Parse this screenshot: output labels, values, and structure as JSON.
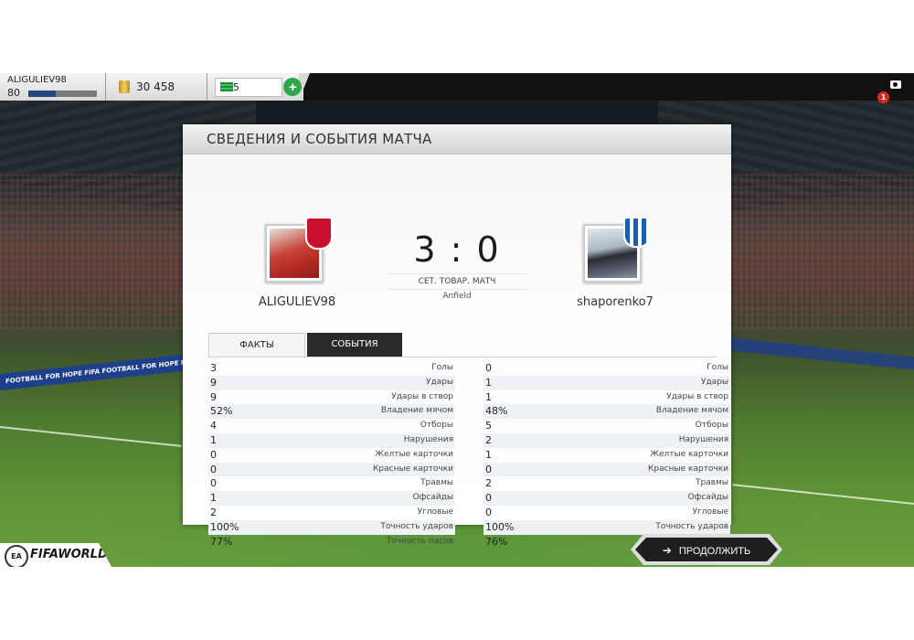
{
  "profile": {
    "username": "ALIGULIEV98",
    "level": "80",
    "progress": 0.4
  },
  "currency": {
    "coins": "30 458",
    "points": "5",
    "add_label": "+"
  },
  "notifications": {
    "count": "1"
  },
  "panel": {
    "title": "СВЕДЕНИЯ И СОБЫТИЯ МАТЧА"
  },
  "match": {
    "home_name": "ALIGULIEV98",
    "away_name": "shaporenko7",
    "score": "3 : 0",
    "type": "СЕТ. ТОВАР. МАТЧ",
    "venue": "Anfield"
  },
  "tabs": {
    "facts": "ФАКТЫ",
    "events": "СОБЫТИЯ"
  },
  "stats": {
    "home": [
      {
        "value": "3",
        "label": "Голы"
      },
      {
        "value": "9",
        "label": "Удары"
      },
      {
        "value": "9",
        "label": "Удары в створ"
      },
      {
        "value": "52%",
        "label": "Владение мячом"
      },
      {
        "value": "4",
        "label": "Отборы"
      },
      {
        "value": "1",
        "label": "Нарушения"
      },
      {
        "value": "0",
        "label": "Желтые карточки"
      },
      {
        "value": "0",
        "label": "Красные карточки"
      },
      {
        "value": "0",
        "label": "Травмы"
      },
      {
        "value": "1",
        "label": "Офсайды"
      },
      {
        "value": "2",
        "label": "Угловые"
      },
      {
        "value": "100%",
        "label": "Точность ударов"
      },
      {
        "value": "77%",
        "label": "Точность пасов"
      }
    ],
    "away": [
      {
        "value": "0",
        "label": "Голы"
      },
      {
        "value": "1",
        "label": "Удары"
      },
      {
        "value": "1",
        "label": "Удары в створ"
      },
      {
        "value": "48%",
        "label": "Владение мячом"
      },
      {
        "value": "5",
        "label": "Отборы"
      },
      {
        "value": "2",
        "label": "Нарушения"
      },
      {
        "value": "1",
        "label": "Желтые карточки"
      },
      {
        "value": "0",
        "label": "Красные карточки"
      },
      {
        "value": "2",
        "label": "Травмы"
      },
      {
        "value": "0",
        "label": "Офсайды"
      },
      {
        "value": "0",
        "label": "Угловые"
      },
      {
        "value": "100%",
        "label": "Точность ударов"
      },
      {
        "value": "76%",
        "label": "Точность пасов"
      }
    ]
  },
  "footer": {
    "continue_label": "ПРОДОЛЖИТЬ",
    "logo_text": "FIFAWORLD",
    "ea_label": "EA"
  },
  "background": {
    "board_text": "FOOTBALL FOR HOPE  FIFA   FOOTBALL FOR HOPE  FIFA"
  },
  "icons": {
    "camera": "camera-icon",
    "coins": "coins-icon",
    "points": "points-icon",
    "continue_arrow": "arrow-right-icon"
  }
}
